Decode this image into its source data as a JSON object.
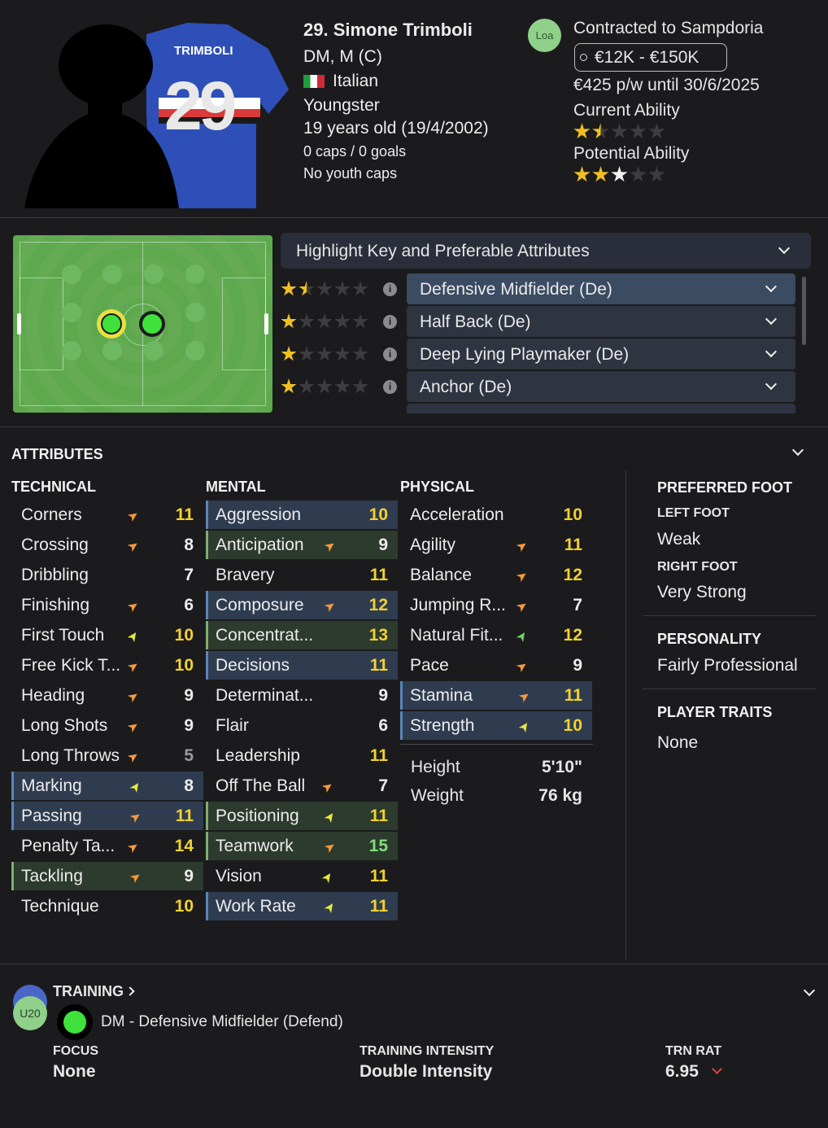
{
  "player": {
    "name_line": "29. Simone Trimboli",
    "positions": "DM, M (C)",
    "nationality": "Italian",
    "status": "Youngster",
    "age_dob": "19 years old (19/4/2002)",
    "caps": "0 caps / 0 goals",
    "youth_caps": "No youth caps",
    "shirt_name": "TRIMBOLI",
    "shirt_number": "29"
  },
  "contract": {
    "badge": "Loa",
    "club": "Contracted to Sampdoria",
    "value_range": "€12K - €150K",
    "wage": "€425 p/w until 30/6/2025",
    "ca_label": "Current Ability",
    "pa_label": "Potential Ability",
    "ca_stars": 1.5,
    "pa_stars": 2.5
  },
  "roles": {
    "header": "Highlight Key and Preferable Attributes",
    "items": [
      {
        "label": "Defensive Midfielder (De)",
        "stars": 1.5
      },
      {
        "label": "Half Back (De)",
        "stars": 1
      },
      {
        "label": "Deep Lying Playmaker (De)",
        "stars": 1
      },
      {
        "label": "Anchor (De)",
        "stars": 1
      }
    ]
  },
  "attributes": {
    "title": "ATTRIBUTES",
    "technical_h": "TECHNICAL",
    "mental_h": "MENTAL",
    "physical_h": "PHYSICAL",
    "technical": [
      {
        "name": "Corners",
        "value": "11",
        "arrow": "o"
      },
      {
        "name": "Crossing",
        "value": "8",
        "arrow": "o"
      },
      {
        "name": "Dribbling",
        "value": "7",
        "arrow": ""
      },
      {
        "name": "Finishing",
        "value": "6",
        "arrow": "o"
      },
      {
        "name": "First Touch",
        "value": "10",
        "arrow": "y"
      },
      {
        "name": "Free Kick T...",
        "value": "10",
        "arrow": "o"
      },
      {
        "name": "Heading",
        "value": "9",
        "arrow": "o"
      },
      {
        "name": "Long Shots",
        "value": "9",
        "arrow": "o"
      },
      {
        "name": "Long Throws",
        "value": "5",
        "arrow": "o"
      },
      {
        "name": "Marking",
        "value": "8",
        "arrow": "y"
      },
      {
        "name": "Passing",
        "value": "11",
        "arrow": "o"
      },
      {
        "name": "Penalty Ta...",
        "value": "14",
        "arrow": "o"
      },
      {
        "name": "Tackling",
        "value": "9",
        "arrow": "o"
      },
      {
        "name": "Technique",
        "value": "10",
        "arrow": ""
      }
    ],
    "mental": [
      {
        "name": "Aggression",
        "value": "10",
        "arrow": ""
      },
      {
        "name": "Anticipation",
        "value": "9",
        "arrow": "o"
      },
      {
        "name": "Bravery",
        "value": "11",
        "arrow": ""
      },
      {
        "name": "Composure",
        "value": "12",
        "arrow": "o"
      },
      {
        "name": "Concentrat...",
        "value": "13",
        "arrow": ""
      },
      {
        "name": "Decisions",
        "value": "11",
        "arrow": ""
      },
      {
        "name": "Determinat...",
        "value": "9",
        "arrow": ""
      },
      {
        "name": "Flair",
        "value": "6",
        "arrow": ""
      },
      {
        "name": "Leadership",
        "value": "11",
        "arrow": ""
      },
      {
        "name": "Off The Ball",
        "value": "7",
        "arrow": "o"
      },
      {
        "name": "Positioning",
        "value": "11",
        "arrow": "y"
      },
      {
        "name": "Teamwork",
        "value": "15",
        "arrow": "o"
      },
      {
        "name": "Vision",
        "value": "11",
        "arrow": "y"
      },
      {
        "name": "Work Rate",
        "value": "11",
        "arrow": "y"
      }
    ],
    "physical": [
      {
        "name": "Acceleration",
        "value": "10",
        "arrow": ""
      },
      {
        "name": "Agility",
        "value": "11",
        "arrow": "o"
      },
      {
        "name": "Balance",
        "value": "12",
        "arrow": "o"
      },
      {
        "name": "Jumping R...",
        "value": "7",
        "arrow": "o"
      },
      {
        "name": "Natural Fit...",
        "value": "12",
        "arrow": "g"
      },
      {
        "name": "Pace",
        "value": "9",
        "arrow": "o"
      },
      {
        "name": "Stamina",
        "value": "11",
        "arrow": "o"
      },
      {
        "name": "Strength",
        "value": "10",
        "arrow": "y"
      }
    ],
    "height_label": "Height",
    "height": "5'10\"",
    "weight_label": "Weight",
    "weight": "76 kg"
  },
  "side": {
    "pref_foot_h": "PREFERRED FOOT",
    "left_foot_h": "LEFT FOOT",
    "left_foot": "Weak",
    "right_foot_h": "RIGHT FOOT",
    "right_foot": "Very Strong",
    "personality_h": "PERSONALITY",
    "personality": "Fairly Professional",
    "traits_h": "PLAYER TRAITS",
    "traits": "None"
  },
  "training": {
    "title": "TRAINING",
    "badge": "U20",
    "role": "DM - Defensive Midfielder (Defend)",
    "focus_h": "FOCUS",
    "focus": "None",
    "intensity_h": "TRAINING INTENSITY",
    "intensity": "Double Intensity",
    "rating_h": "TRN RAT",
    "rating": "6.95"
  },
  "colors": {
    "accent_blue": "#3a4b62",
    "value_yellow": "#f2d230",
    "value_green": "#7fe07a",
    "arrow_orange": "#f39a3c",
    "star_gold": "#f0c020"
  }
}
